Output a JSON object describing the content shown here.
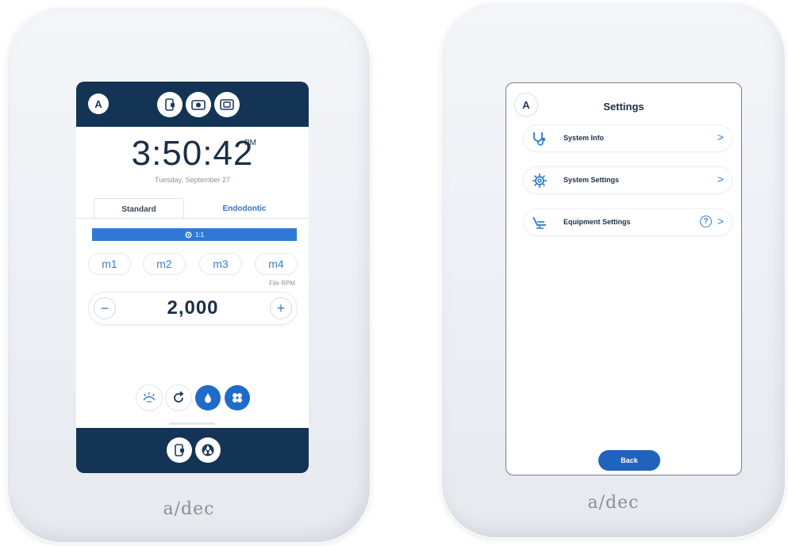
{
  "brand": "a/dec",
  "left_screen": {
    "avatar": "A",
    "clock": {
      "time": "3:50:42",
      "ampm": "PM",
      "date": "Tuesday, September 27"
    },
    "tabs": [
      {
        "label": "Standard",
        "active": true
      },
      {
        "label": "Endodontic",
        "active": false
      }
    ],
    "speed_bar": {
      "icon": "gear-icon",
      "label": "1:1"
    },
    "memory_buttons": [
      "m1",
      "m2",
      "m3",
      "m4"
    ],
    "file_rpm_label": "File RPM",
    "rpm": {
      "value": "2,000",
      "minus": "−",
      "plus": "+"
    },
    "mode_buttons": [
      {
        "icon": "light-icon",
        "active": false
      },
      {
        "icon": "reverse-icon",
        "active": false
      },
      {
        "icon": "water-drop-icon",
        "active": true
      },
      {
        "icon": "air-icon",
        "active": true
      }
    ],
    "colors": {
      "header": "#133454",
      "accent": "#2f7ad6"
    }
  },
  "right_screen": {
    "avatar": "A",
    "title": "Settings",
    "menu_items": [
      {
        "label": "System Info",
        "icon": "stethoscope-icon",
        "help": false
      },
      {
        "label": "System Settings",
        "icon": "gear-icon",
        "help": false
      },
      {
        "label": "Equipment Settings",
        "icon": "dental-chair-icon",
        "help": true,
        "help_glyph": "?"
      }
    ],
    "chevron": ">",
    "back_label": "Back"
  }
}
